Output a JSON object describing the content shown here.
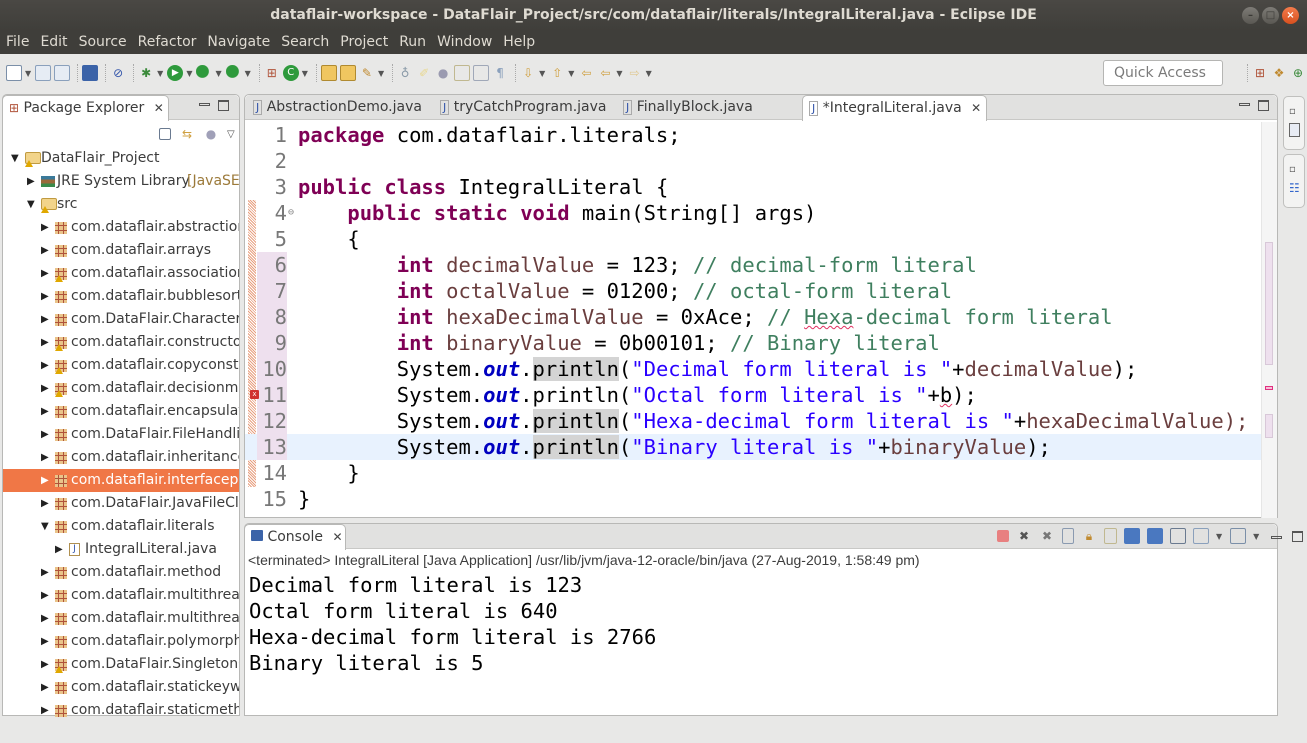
{
  "window": {
    "title": "dataflair-workspace - DataFlair_Project/src/com/dataflair/literals/IntegralLiteral.java - Eclipse IDE",
    "controls": [
      "minimize",
      "maximize",
      "close"
    ]
  },
  "menu": [
    "File",
    "Edit",
    "Source",
    "Refactor",
    "Navigate",
    "Search",
    "Project",
    "Run",
    "Window",
    "Help"
  ],
  "toolbar": {
    "quick_access_placeholder": "Quick Access",
    "icons": [
      "new-wizard-icon",
      "save-icon",
      "save-all-icon",
      "terminal-icon",
      "skip-breakpoints-icon",
      "debug-icon",
      "run-icon",
      "run-coverage-icon",
      "external-tools-icon",
      "new-package-icon",
      "new-class-icon",
      "open-type-icon",
      "open-task-icon",
      "search-icon",
      "annotation-icon",
      "highlight-icon",
      "toggle-mark-icon",
      "block-select-icon",
      "show-whitespace-icon",
      "next-annotation-icon",
      "prev-annotation-icon",
      "last-edit-icon",
      "back-icon",
      "forward-icon"
    ],
    "perspective_icons": [
      "open-perspective-icon",
      "java-ee-perspective-icon",
      "java-perspective-icon"
    ]
  },
  "package_explorer": {
    "title": "Package Explorer",
    "tree": [
      {
        "label": "DataFlair_Project",
        "level": 0,
        "expanded": true,
        "icon": "project-icon",
        "warning": true
      },
      {
        "label": "JRE System Library",
        "suffix": "[JavaSE-",
        "level": 1,
        "expanded": false,
        "icon": "library-icon"
      },
      {
        "label": "src",
        "level": 1,
        "expanded": true,
        "icon": "source-folder-icon",
        "warning": true
      },
      {
        "label": "com.dataflair.abstraction",
        "level": 2,
        "expanded": false,
        "icon": "package-icon"
      },
      {
        "label": "com.dataflair.arrays",
        "level": 2,
        "expanded": false,
        "icon": "package-icon"
      },
      {
        "label": "com.dataflair.association",
        "level": 2,
        "expanded": false,
        "icon": "package-icon",
        "warning": true
      },
      {
        "label": "com.dataflair.bubblesort",
        "level": 2,
        "expanded": false,
        "icon": "package-icon"
      },
      {
        "label": "com.DataFlair.CharacterC",
        "level": 2,
        "expanded": false,
        "icon": "package-icon"
      },
      {
        "label": "com.dataflair.constructo",
        "level": 2,
        "expanded": false,
        "icon": "package-icon",
        "warning": true
      },
      {
        "label": "com.dataflair.copyconstr",
        "level": 2,
        "expanded": false,
        "icon": "package-icon",
        "warning": true
      },
      {
        "label": "com.dataflair.decisionma",
        "level": 2,
        "expanded": false,
        "icon": "package-icon",
        "warning": true
      },
      {
        "label": "com.dataflair.encapsulat",
        "level": 2,
        "expanded": false,
        "icon": "package-icon"
      },
      {
        "label": "com.DataFlair.FileHandlin",
        "level": 2,
        "expanded": false,
        "icon": "package-icon"
      },
      {
        "label": "com.dataflair.inheritance",
        "level": 2,
        "expanded": false,
        "icon": "package-icon"
      },
      {
        "label": "com.dataflair.interfacepr",
        "level": 2,
        "expanded": false,
        "icon": "package-icon",
        "selected": true
      },
      {
        "label": "com.DataFlair.JavaFileCla",
        "level": 2,
        "expanded": false,
        "icon": "package-icon"
      },
      {
        "label": "com.dataflair.literals",
        "level": 2,
        "expanded": true,
        "icon": "package-icon"
      },
      {
        "label": "IntegralLiteral.java",
        "level": 3,
        "expanded": false,
        "icon": "java-file-icon"
      },
      {
        "label": "com.dataflair.method",
        "level": 2,
        "expanded": false,
        "icon": "package-icon"
      },
      {
        "label": "com.dataflair.multithread",
        "level": 2,
        "expanded": false,
        "icon": "package-icon"
      },
      {
        "label": "com.dataflair.multithread",
        "level": 2,
        "expanded": false,
        "icon": "package-icon"
      },
      {
        "label": "com.dataflair.polymorph",
        "level": 2,
        "expanded": false,
        "icon": "package-icon"
      },
      {
        "label": "com.DataFlair.SingletonC",
        "level": 2,
        "expanded": false,
        "icon": "package-icon",
        "warning": true
      },
      {
        "label": "com.dataflair.statickeyw",
        "level": 2,
        "expanded": false,
        "icon": "package-icon"
      },
      {
        "label": "com.dataflair.staticmeth",
        "level": 2,
        "expanded": false,
        "icon": "package-icon"
      }
    ]
  },
  "editor": {
    "tabs": [
      {
        "label": "AbstractionDemo.java",
        "active": false
      },
      {
        "label": "tryCatchProgram.java",
        "active": false
      },
      {
        "label": "FinallyBlock.java",
        "active": false
      },
      {
        "label": "*IntegralLiteral.java",
        "active": true
      }
    ],
    "current_line": 13,
    "lines": [
      {
        "n": "1",
        "tokens": [
          [
            "kw",
            "package"
          ],
          [
            "",
            " com.dataflair.literals;"
          ]
        ]
      },
      {
        "n": "2",
        "tokens": []
      },
      {
        "n": "3",
        "tokens": [
          [
            "kw",
            "public"
          ],
          [
            "",
            " "
          ],
          [
            "kw",
            "class"
          ],
          [
            "",
            " IntegralLiteral {"
          ]
        ]
      },
      {
        "n": "4",
        "fold": true,
        "tokens": [
          [
            "",
            "    "
          ],
          [
            "kw",
            "public"
          ],
          [
            "",
            " "
          ],
          [
            "kw",
            "static"
          ],
          [
            "",
            " "
          ],
          [
            "kw",
            "void"
          ],
          [
            "",
            " main(String[] args)"
          ]
        ]
      },
      {
        "n": "5",
        "tokens": [
          [
            "",
            "    {"
          ]
        ]
      },
      {
        "n": "6",
        "tokens": [
          [
            "",
            "        "
          ],
          [
            "kw",
            "int"
          ],
          [
            "",
            " "
          ],
          [
            "var",
            "decimalValue"
          ],
          [
            "",
            " = 123; "
          ],
          [
            "cmt",
            "// decimal-form literal"
          ]
        ]
      },
      {
        "n": "7",
        "tokens": [
          [
            "",
            "        "
          ],
          [
            "kw",
            "int"
          ],
          [
            "",
            " "
          ],
          [
            "var",
            "octalValue"
          ],
          [
            "",
            " = 01200; "
          ],
          [
            "cmt",
            "// octal-form literal"
          ]
        ]
      },
      {
        "n": "8",
        "tokens": [
          [
            "",
            "        "
          ],
          [
            "kw",
            "int"
          ],
          [
            "",
            " "
          ],
          [
            "var",
            "hexaDecimalValue"
          ],
          [
            "",
            " = 0xAce; "
          ],
          [
            "cmt",
            "// "
          ],
          [
            "cmt squig",
            "Hexa"
          ],
          [
            "cmt",
            "-decimal form literal"
          ]
        ]
      },
      {
        "n": "9",
        "tokens": [
          [
            "",
            "        "
          ],
          [
            "kw",
            "int"
          ],
          [
            "",
            " "
          ],
          [
            "var",
            "binaryValue"
          ],
          [
            "",
            " = 0b00101; "
          ],
          [
            "cmt",
            "// Binary literal"
          ]
        ]
      },
      {
        "n": "10",
        "tokens": [
          [
            "",
            "        System."
          ],
          [
            "fld",
            "out"
          ],
          [
            "",
            "."
          ],
          [
            "occ",
            "println"
          ],
          [
            "",
            "("
          ],
          [
            "str",
            "\"Decimal form literal is \""
          ],
          [
            "",
            "+"
          ],
          [
            "var",
            "decimalValue"
          ],
          [
            "",
            ");"
          ]
        ]
      },
      {
        "n": "11",
        "error": true,
        "tokens": [
          [
            "",
            "        System."
          ],
          [
            "fld",
            "out"
          ],
          [
            "",
            ".println("
          ],
          [
            "str",
            "\"Octal form literal is \""
          ],
          [
            "",
            "+"
          ],
          [
            "squig",
            "b"
          ],
          [
            "",
            ");"
          ]
        ]
      },
      {
        "n": "12",
        "tokens": [
          [
            "",
            "        System."
          ],
          [
            "fld",
            "out"
          ],
          [
            "",
            "."
          ],
          [
            "occ",
            "println"
          ],
          [
            "",
            "("
          ],
          [
            "str",
            "\"Hexa-decimal form literal is \""
          ],
          [
            "",
            "+"
          ],
          [
            "var",
            "hexaDecimalValue);"
          ]
        ]
      },
      {
        "n": "13",
        "tokens": [
          [
            "",
            "        System."
          ],
          [
            "fld",
            "out"
          ],
          [
            "",
            "."
          ],
          [
            "occ",
            "println"
          ],
          [
            "",
            "("
          ],
          [
            "str",
            "\"Binary literal is \""
          ],
          [
            "",
            "+"
          ],
          [
            "var",
            "binaryValue"
          ],
          [
            "",
            ");"
          ]
        ]
      },
      {
        "n": "14",
        "tokens": [
          [
            "",
            "    }"
          ]
        ]
      },
      {
        "n": "15",
        "tokens": [
          [
            "",
            "}"
          ]
        ]
      }
    ]
  },
  "console": {
    "title": "Console",
    "status": "<terminated> IntegralLiteral [Java Application] /usr/lib/jvm/java-12-oracle/bin/java (27-Aug-2019, 1:58:49 pm)",
    "output": [
      "Decimal form literal is 123",
      "Octal form literal is 640",
      "Hexa-decimal form literal is 2766",
      "Binary literal is 5"
    ],
    "toolbar_icons": [
      "terminate-icon",
      "remove-launch-icon",
      "remove-all-terminated-icon",
      "clear-console-icon",
      "scroll-lock-icon",
      "word-wrap-icon",
      "show-on-stdout-icon",
      "show-on-stderr-icon",
      "pin-console-icon",
      "display-console-icon",
      "open-console-icon"
    ]
  },
  "colors": {
    "selection": "#f07746",
    "keyword": "#7f0055",
    "string": "#2a00ff",
    "comment": "#3f7f5f",
    "field": "#0000c0",
    "variable": "#6a3e3e",
    "current_line": "#e8f2fe"
  }
}
